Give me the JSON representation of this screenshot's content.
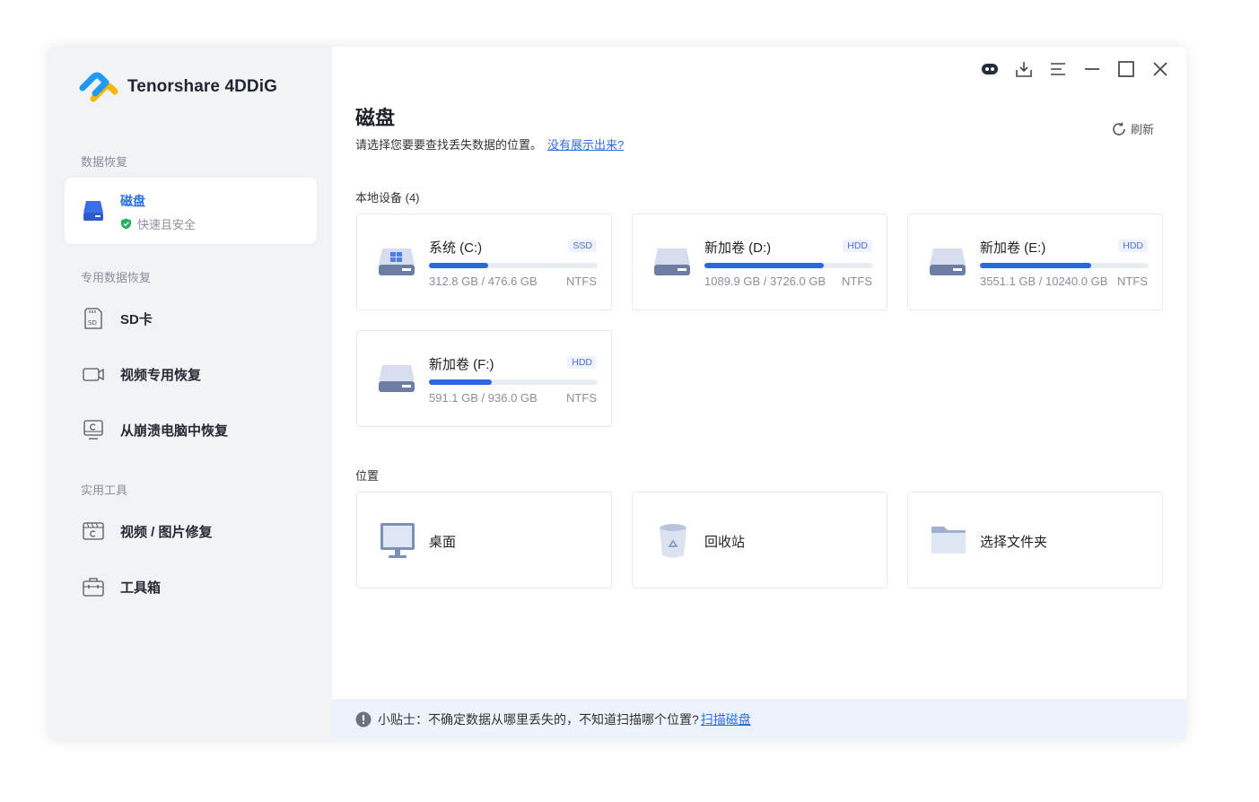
{
  "app": {
    "name": "Tenorshare 4DDiG"
  },
  "sidebar": {
    "sections": {
      "recovery": "数据恢复",
      "special": "专用数据恢复",
      "tools": "实用工具"
    },
    "active": {
      "label": "磁盘",
      "sub": "快速且安全"
    },
    "items": [
      {
        "label": "SD卡"
      },
      {
        "label": "视频专用恢复"
      },
      {
        "label": "从崩溃电脑中恢复"
      },
      {
        "label": "视频 / 图片修复"
      },
      {
        "label": "工具箱"
      }
    ]
  },
  "main": {
    "title": "磁盘",
    "subtitle": "请选择您要要查找丢失数据的位置。",
    "link": "没有展示出来?",
    "refresh": "刷新",
    "local_devices": "本地设备 (4)",
    "locations_title": "位置",
    "drives": [
      {
        "name": "系统 (C:)",
        "tag": "SSD",
        "size": "312.8 GB / 476.6 GB",
        "fs": "NTFS",
        "used_fraction": 0.35
      },
      {
        "name": "新加卷 (D:)",
        "tag": "HDD",
        "size": "1089.9 GB / 3726.0 GB",
        "fs": "NTFS",
        "used_fraction": 0.71
      },
      {
        "name": "新加卷 (E:)",
        "tag": "HDD",
        "size": "3551.1 GB / 10240.0 GB",
        "fs": "NTFS",
        "used_fraction": 0.66
      },
      {
        "name": "新加卷 (F:)",
        "tag": "HDD",
        "size": "591.1 GB / 936.0 GB",
        "fs": "NTFS",
        "used_fraction": 0.37
      }
    ],
    "locations": [
      {
        "name": "桌面",
        "icon": "desktop-icon"
      },
      {
        "name": "回收站",
        "icon": "recycle-bin-icon"
      },
      {
        "name": "选择文件夹",
        "icon": "folder-icon"
      }
    ],
    "tip": {
      "text": "小贴士：不确定数据从哪里丢失的，不知道扫描哪个位置?",
      "link": "扫描磁盘"
    }
  },
  "colors": {
    "accent": "#2c67e3",
    "sidebar_bg": "#f1f3f7",
    "tip_bg": "#edf2fc"
  }
}
